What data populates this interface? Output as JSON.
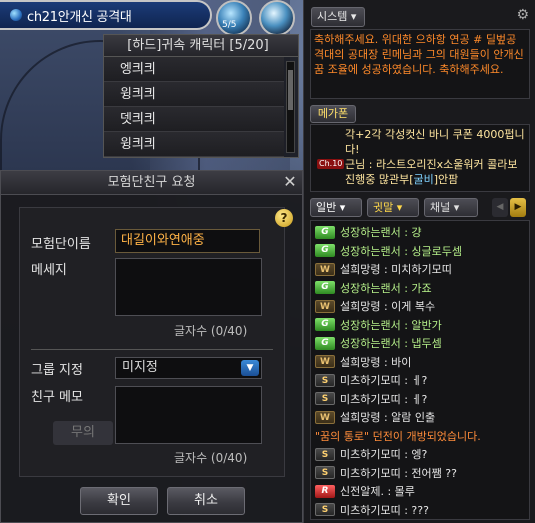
{
  "channel": {
    "name": "ch21안개신 공격대",
    "orb_label": "5/5"
  },
  "charlist": {
    "title": "[하드]귀속 캐릭터 [5/20]",
    "items": [
      "엥킈킈",
      "윙킈킈",
      "뎃킈킈",
      "윙킈킈"
    ]
  },
  "dialog": {
    "title": "모험단친구 요청",
    "close_glyph": "✕",
    "help_glyph": "?",
    "adventurer_label": "모험단이름",
    "adventurer_value": "대길이와연애중",
    "message_label": "메세지",
    "message_counter": "글자수 (0/40)",
    "group_label": "그룹 지정",
    "group_value": "미지정",
    "memo_label": "친구 메모",
    "memo_counter": "글자수 (0/40)",
    "ghost_button": "무의",
    "ok_label": "확인",
    "cancel_label": "취소"
  },
  "system": {
    "tab_label": "시스템 ▾",
    "message": "축하해주세요. 위대한 으하항 연공 # 딜벞공격대의 공대장 린메님과 그의 대원들이 안개신 꿈 조율에 성공하였습니다. 축하해주세요."
  },
  "megaphone": {
    "tab_label": "메가폰",
    "line1": "각+2각 각성컷신 바니 쿠폰 4000펍니다!",
    "level_badge": "Ch.10",
    "line2_pre": "근님 : 라스트오리진x소울워커 콜라보 진행중 많관부[",
    "line2_blue": "굴비",
    "line2_post": "]안팜"
  },
  "chat_tabs": {
    "general": "일반 ▾",
    "guild": "귓말 ▾",
    "channel": "채널 ▾",
    "left_arrow": "◀",
    "right_arrow": "▶"
  },
  "chat": [
    {
      "badge": "G",
      "kind": "g",
      "text": "성장하는랜서 : 걍",
      "color": "guild"
    },
    {
      "badge": "G",
      "kind": "g",
      "text": "성장하는랜서 : 싱글로두셈",
      "color": "guild"
    },
    {
      "badge": "W",
      "kind": "w",
      "text": "설희망령 : 미치하기모띠",
      "color": "whisper"
    },
    {
      "badge": "G",
      "kind": "g",
      "text": "성장하는랜서 : 가죠",
      "color": "guild"
    },
    {
      "badge": "W",
      "kind": "w",
      "text": "설희망령 : 이게 복수",
      "color": "whisper"
    },
    {
      "badge": "G",
      "kind": "g",
      "text": "성장하는랜서 : 알반가",
      "color": "guild"
    },
    {
      "badge": "G",
      "kind": "g",
      "text": "성장하는랜서 : 냅두셈",
      "color": "guild"
    },
    {
      "badge": "W",
      "kind": "w",
      "text": "설희망령 : 바이",
      "color": "whisper"
    },
    {
      "badge": "S",
      "kind": "s",
      "text": "미츠하기모띠 : ㅔ?",
      "color": "normal"
    },
    {
      "badge": "S",
      "kind": "s",
      "text": "미츠하기모띠 : ㅔ?",
      "color": "normal"
    },
    {
      "badge": "W",
      "kind": "w",
      "text": "설희망령 : 알람 인출",
      "color": "whisper"
    },
    {
      "badge": "",
      "kind": "",
      "text": "\"꿈의 통로\" 던전이 개방되었습니다.",
      "color": "notice"
    },
    {
      "badge": "S",
      "kind": "s",
      "text": "미츠하기모띠 : 엥?",
      "color": "normal"
    },
    {
      "badge": "S",
      "kind": "s",
      "text": "미츠하기모띠 : 전어쨈 ??",
      "color": "normal"
    },
    {
      "badge": "R",
      "kind": "r",
      "text": "신전알제. : 몰루",
      "color": "normal"
    },
    {
      "badge": "S",
      "kind": "s",
      "text": "미츠하기모띠 : ???",
      "color": "normal"
    }
  ]
}
